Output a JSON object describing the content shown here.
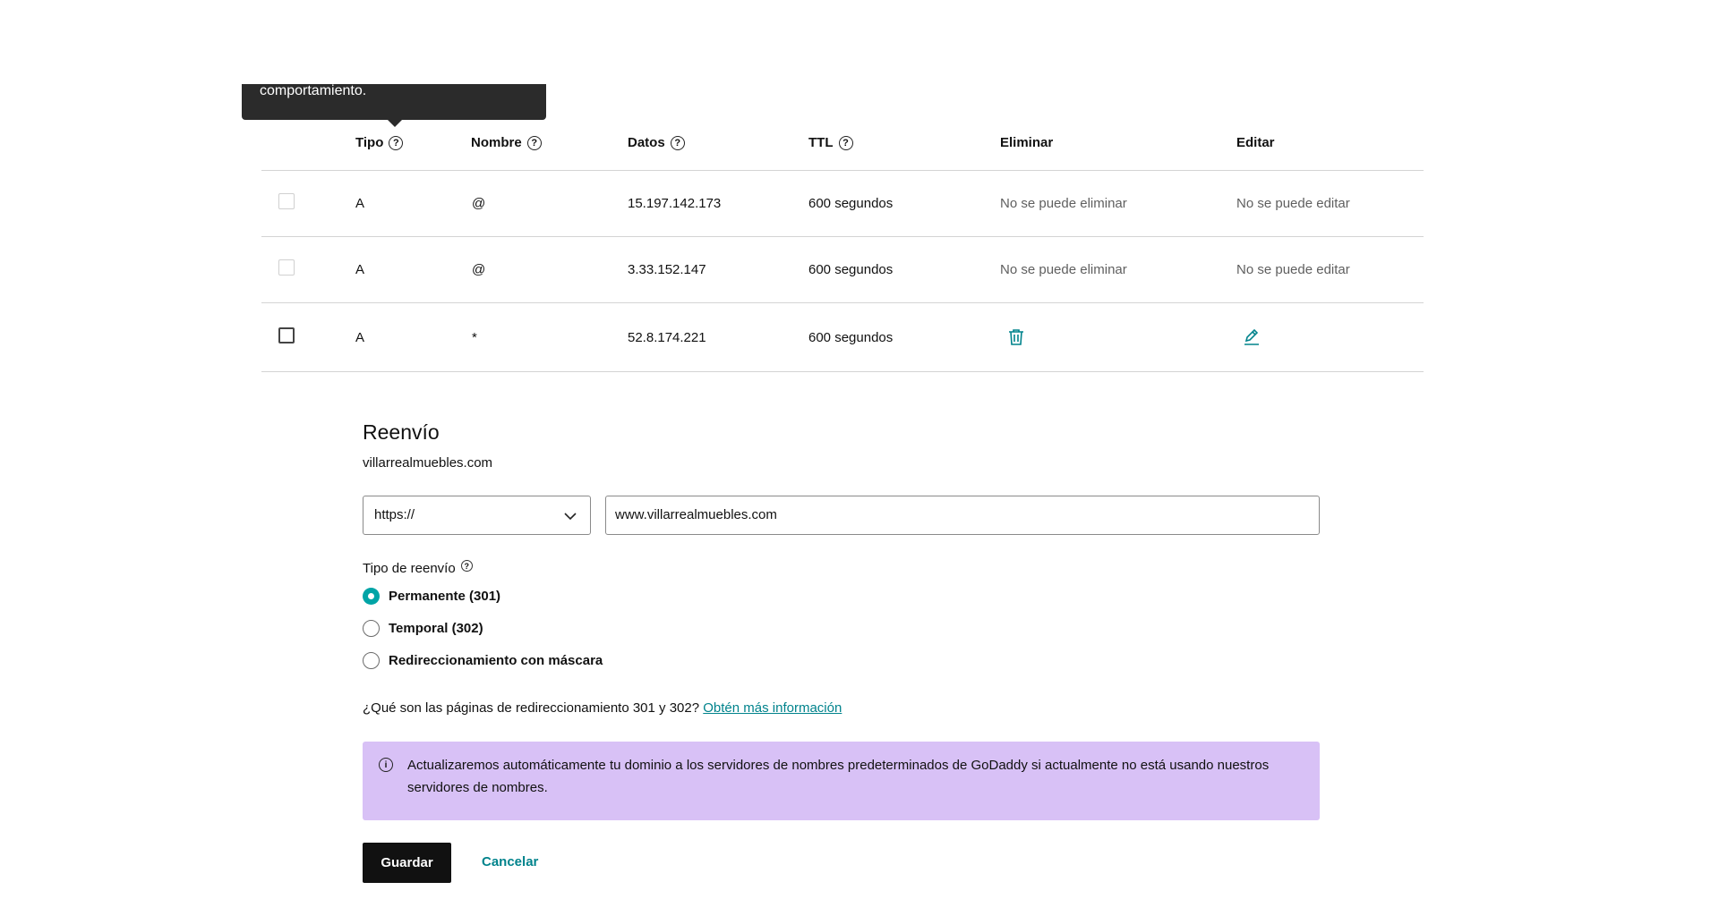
{
  "tooltip": {
    "text": "comportamiento."
  },
  "table": {
    "headers": {
      "tipo": "Tipo",
      "nombre": "Nombre",
      "datos": "Datos",
      "ttl": "TTL",
      "eliminar": "Eliminar",
      "editar": "Editar"
    },
    "rows": [
      {
        "type": "A",
        "name": "@",
        "data": "15.197.142.173",
        "ttl": "600 segundos",
        "delete": "No se puede eliminar",
        "edit": "No se puede editar"
      },
      {
        "type": "A",
        "name": "@",
        "data": "3.33.152.147",
        "ttl": "600 segundos",
        "delete": "No se puede eliminar",
        "edit": "No se puede editar"
      },
      {
        "type": "A",
        "name": "*",
        "data": "52.8.174.221",
        "ttl": "600 segundos",
        "delete_icon": "trash-icon",
        "edit_icon": "pencil-icon"
      }
    ]
  },
  "forwarding": {
    "title": "Reenvío",
    "domain": "villarrealmuebles.com",
    "protocol": "https://",
    "destination": "www.villarrealmuebles.com",
    "type_label": "Tipo de reenvío",
    "options": [
      "Permanente (301)",
      "Temporal (302)",
      "Redireccionamiento con máscara"
    ],
    "selected_option": "Permanente (301)",
    "help_text": "¿Qué son las páginas de redireccionamiento 301 y 302?",
    "help_link": "Obtén más información",
    "info_text": "Actualizaremos automáticamente tu dominio a los servidores de nombres predeterminados de GoDaddy si actualmente no está usando nuestros servidores de nombres.",
    "save_label": "Guardar",
    "cancel_label": "Cancelar"
  },
  "colors": {
    "accent": "#00a4a6",
    "link": "#00838c",
    "info_bg": "#d8c1f6",
    "tooltip_bg": "#2b2b2b"
  }
}
